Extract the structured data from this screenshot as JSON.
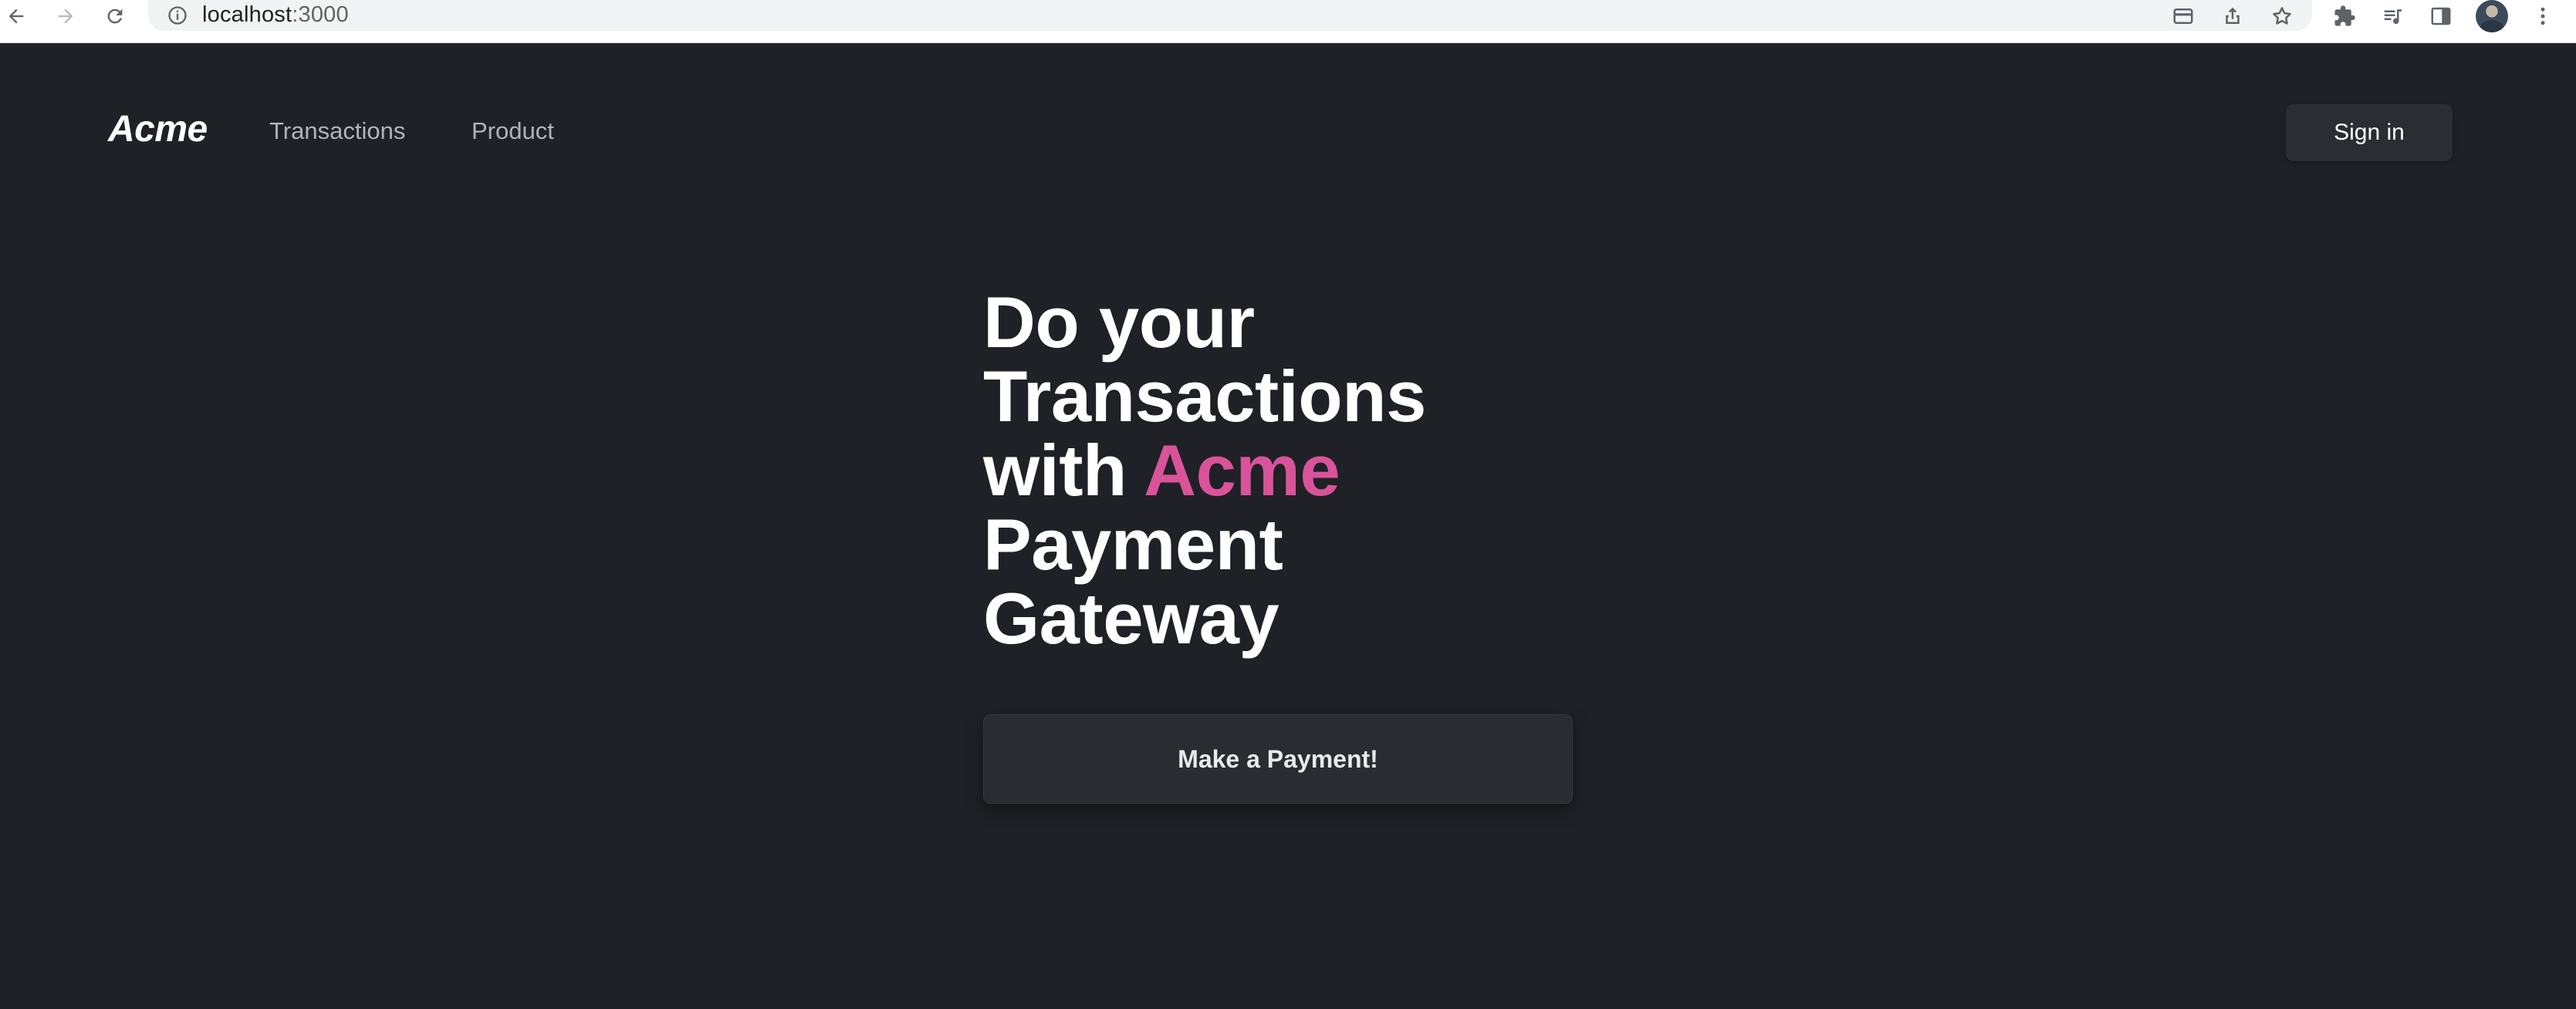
{
  "browser": {
    "url_host": "localhost",
    "url_port": ":3000",
    "icons": {
      "back": "arrow-left-icon",
      "forward": "arrow-right-icon",
      "reload": "reload-icon",
      "site_info": "info-icon",
      "card": "credit-card-icon",
      "share": "share-icon",
      "bookmark": "star-icon",
      "extensions": "puzzle-icon",
      "media": "playlist-icon",
      "side_panel": "side-panel-icon",
      "profile": "avatar",
      "menu": "kebab-menu-icon"
    }
  },
  "nav": {
    "brand": "Acme",
    "links": [
      "Transactions",
      "Product"
    ],
    "signin_label": "Sign in"
  },
  "hero": {
    "line1": "Do your",
    "line2": "Transactions",
    "line3_prefix": "with ",
    "line3_accent": "Acme",
    "line4": "Payment",
    "line5": "Gateway",
    "cta_label": "Make a Payment!"
  },
  "colors": {
    "background": "#1f2126",
    "accent": "#d9539a",
    "button_bg": "#2a2c31"
  }
}
